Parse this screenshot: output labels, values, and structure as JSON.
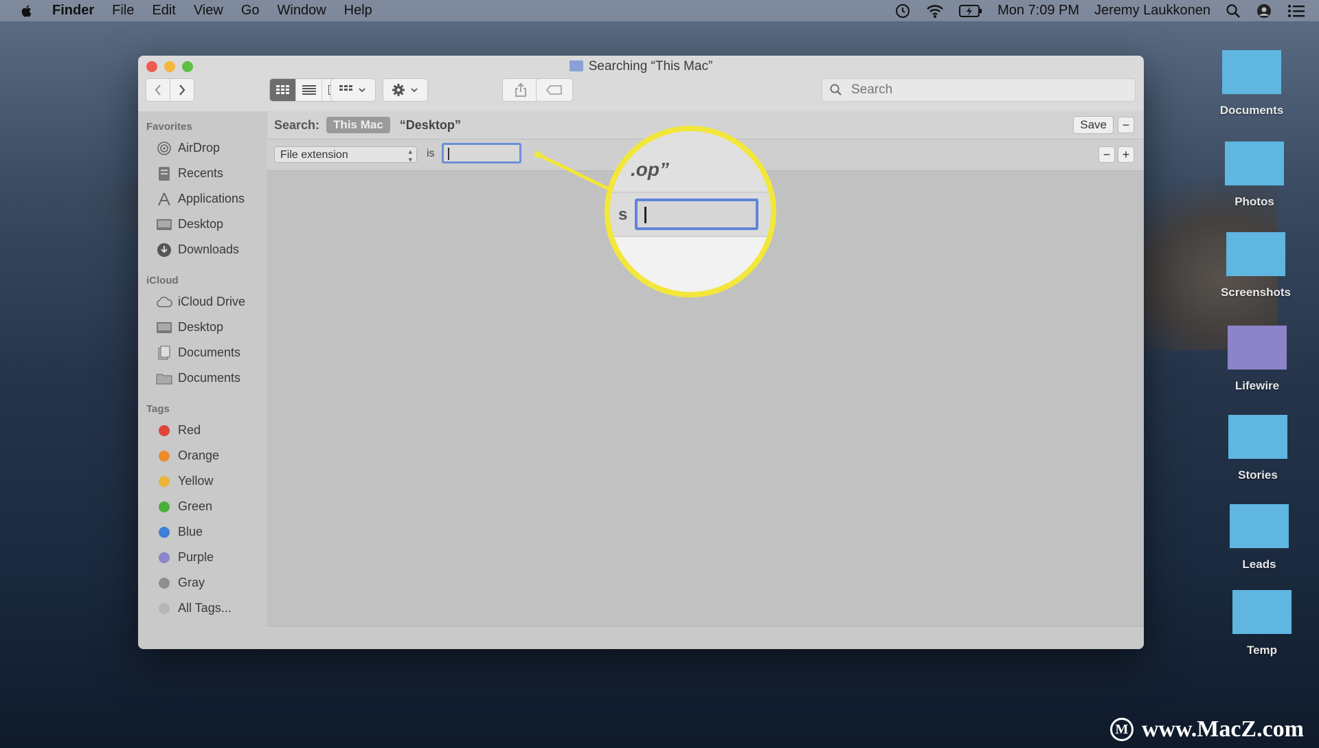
{
  "menubar": {
    "items": [
      "Finder",
      "File",
      "Edit",
      "View",
      "Go",
      "Window",
      "Help"
    ],
    "clock": "Mon 7:09 PM",
    "user": "Jeremy Laukkonen"
  },
  "window": {
    "title": "Searching “This Mac”",
    "search_placeholder": "Search"
  },
  "sidebar": {
    "favorites_header": "Favorites",
    "favorites": [
      {
        "label": "AirDrop",
        "icon": "airdrop-icon"
      },
      {
        "label": "Recents",
        "icon": "recents-icon"
      },
      {
        "label": "Applications",
        "icon": "applications-icon"
      },
      {
        "label": "Desktop",
        "icon": "desktop-icon"
      },
      {
        "label": "Downloads",
        "icon": "downloads-icon"
      }
    ],
    "icloud_header": "iCloud",
    "icloud": [
      {
        "label": "iCloud Drive",
        "icon": "cloud-icon"
      },
      {
        "label": "Desktop",
        "icon": "desktop-icon"
      },
      {
        "label": "Documents",
        "icon": "documents-icon"
      },
      {
        "label": "Documents",
        "icon": "folder-icon"
      }
    ],
    "tags_header": "Tags",
    "tags": [
      {
        "label": "Red",
        "color": "#e0443b"
      },
      {
        "label": "Orange",
        "color": "#ee8a2e"
      },
      {
        "label": "Yellow",
        "color": "#e9b53a"
      },
      {
        "label": "Green",
        "color": "#4cae3d"
      },
      {
        "label": "Blue",
        "color": "#3f7fd6"
      },
      {
        "label": "Purple",
        "color": "#8d86c9"
      },
      {
        "label": "Gray",
        "color": "#8e8e8e"
      },
      {
        "label": "All Tags...",
        "color": "#b5b5b5"
      }
    ]
  },
  "search": {
    "label": "Search:",
    "scope_active": "This Mac",
    "scope_other": "“Desktop”",
    "save_label": "Save",
    "minus": "−",
    "plus": "+"
  },
  "rule": {
    "attribute": "File extension",
    "operator": "is",
    "value": ""
  },
  "magnifier": {
    "text_top": ".op”",
    "text_s": "s"
  },
  "desktop_icons": [
    {
      "label": "Documents",
      "color": "#5fb6e0"
    },
    {
      "label": "Photos",
      "color": "#5fb6e0"
    },
    {
      "label": "Screenshots",
      "color": "#5fb6e0"
    },
    {
      "label": "Lifewire",
      "color": "#8c83c9"
    },
    {
      "label": "Stories",
      "color": "#5fb6e0"
    },
    {
      "label": "Leads",
      "color": "#5fb6e0"
    },
    {
      "label": "Temp",
      "color": "#5fb6e0"
    }
  ],
  "watermark": {
    "text": "www.MacZ.com",
    "icon": "M"
  }
}
